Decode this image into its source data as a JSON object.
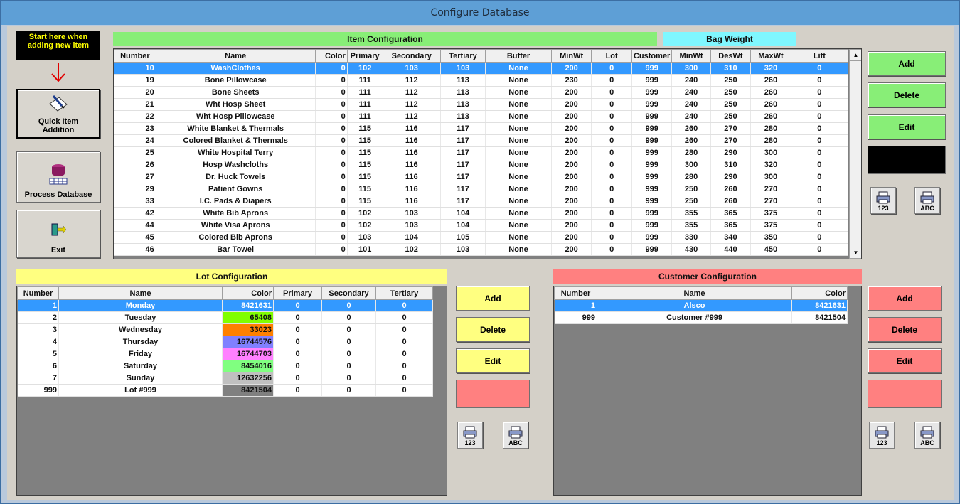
{
  "window": {
    "title": "Configure Database"
  },
  "sidebar": {
    "hint": "Start here when adding new item",
    "quick_item": "Quick Item Addition",
    "process_db": "Process Database",
    "exit": "Exit"
  },
  "item_config": {
    "title": "Item Configuration",
    "bag_weight_title": "Bag Weight",
    "columns": [
      "Number",
      "Name",
      "Color",
      "Primary",
      "Secondary",
      "Tertiary",
      "Buffer",
      "MinWt",
      "Lot",
      "Customer",
      "MinWt",
      "DesWt",
      "MaxWt",
      "Lift"
    ],
    "rows": [
      [
        "10",
        "WashClothes",
        "0",
        "102",
        "103",
        "103",
        "None",
        "200",
        "0",
        "999",
        "300",
        "310",
        "320",
        "0"
      ],
      [
        "19",
        "Bone Pillowcase",
        "0",
        "111",
        "112",
        "113",
        "None",
        "230",
        "0",
        "999",
        "240",
        "250",
        "260",
        "0"
      ],
      [
        "20",
        "Bone Sheets",
        "0",
        "111",
        "112",
        "113",
        "None",
        "200",
        "0",
        "999",
        "240",
        "250",
        "260",
        "0"
      ],
      [
        "21",
        "Wht Hosp Sheet",
        "0",
        "111",
        "112",
        "113",
        "None",
        "200",
        "0",
        "999",
        "240",
        "250",
        "260",
        "0"
      ],
      [
        "22",
        "Wht Hosp Pillowcase",
        "0",
        "111",
        "112",
        "113",
        "None",
        "200",
        "0",
        "999",
        "240",
        "250",
        "260",
        "0"
      ],
      [
        "23",
        "White Blanket & Thermals",
        "0",
        "115",
        "116",
        "117",
        "None",
        "200",
        "0",
        "999",
        "260",
        "270",
        "280",
        "0"
      ],
      [
        "24",
        "Colored Blanket & Thermals",
        "0",
        "115",
        "116",
        "117",
        "None",
        "200",
        "0",
        "999",
        "260",
        "270",
        "280",
        "0"
      ],
      [
        "25",
        "White Hospital Terry",
        "0",
        "115",
        "116",
        "117",
        "None",
        "200",
        "0",
        "999",
        "280",
        "290",
        "300",
        "0"
      ],
      [
        "26",
        "Hosp Washcloths",
        "0",
        "115",
        "116",
        "117",
        "None",
        "200",
        "0",
        "999",
        "300",
        "310",
        "320",
        "0"
      ],
      [
        "27",
        "Dr. Huck Towels",
        "0",
        "115",
        "116",
        "117",
        "None",
        "200",
        "0",
        "999",
        "280",
        "290",
        "300",
        "0"
      ],
      [
        "29",
        "Patient Gowns",
        "0",
        "115",
        "116",
        "117",
        "None",
        "200",
        "0",
        "999",
        "250",
        "260",
        "270",
        "0"
      ],
      [
        "33",
        "I.C. Pads & Diapers",
        "0",
        "115",
        "116",
        "117",
        "None",
        "200",
        "0",
        "999",
        "250",
        "260",
        "270",
        "0"
      ],
      [
        "42",
        "White Bib Aprons",
        "0",
        "102",
        "103",
        "104",
        "None",
        "200",
        "0",
        "999",
        "355",
        "365",
        "375",
        "0"
      ],
      [
        "44",
        "White Visa Aprons",
        "0",
        "102",
        "103",
        "104",
        "None",
        "200",
        "0",
        "999",
        "355",
        "365",
        "375",
        "0"
      ],
      [
        "45",
        "Colored Bib Aprons",
        "0",
        "103",
        "104",
        "105",
        "None",
        "200",
        "0",
        "999",
        "330",
        "340",
        "350",
        "0"
      ],
      [
        "46",
        "Bar Towel",
        "0",
        "101",
        "102",
        "103",
        "None",
        "200",
        "0",
        "999",
        "430",
        "440",
        "450",
        "0"
      ]
    ],
    "buttons": {
      "add": "Add",
      "delete": "Delete",
      "edit": "Edit"
    },
    "print_num": "123",
    "print_abc": "ABC"
  },
  "lot_config": {
    "title": "Lot Configuration",
    "columns": [
      "Number",
      "Name",
      "Color",
      "Primary",
      "Secondary",
      "Tertiary"
    ],
    "rows": [
      {
        "cells": [
          "1",
          "Monday",
          "8421631",
          "0",
          "0",
          "0"
        ],
        "color": "#3399ff"
      },
      {
        "cells": [
          "2",
          "Tuesday",
          "65408",
          "0",
          "0",
          "0"
        ],
        "color": "#80ff00"
      },
      {
        "cells": [
          "3",
          "Wednesday",
          "33023",
          "0",
          "0",
          "0"
        ],
        "color": "#ff8000"
      },
      {
        "cells": [
          "4",
          "Thursday",
          "16744576",
          "0",
          "0",
          "0"
        ],
        "color": "#8080ff"
      },
      {
        "cells": [
          "5",
          "Friday",
          "16744703",
          "0",
          "0",
          "0"
        ],
        "color": "#ff80ff"
      },
      {
        "cells": [
          "6",
          "Saturday",
          "8454016",
          "0",
          "0",
          "0"
        ],
        "color": "#80ff80"
      },
      {
        "cells": [
          "7",
          "Sunday",
          "12632256",
          "0",
          "0",
          "0"
        ],
        "color": "#c0c0c0"
      },
      {
        "cells": [
          "999",
          "Lot #999",
          "8421504",
          "0",
          "0",
          "0"
        ],
        "color": "#808080"
      }
    ],
    "buttons": {
      "add": "Add",
      "delete": "Delete",
      "edit": "Edit"
    },
    "print_num": "123",
    "print_abc": "ABC"
  },
  "customer_config": {
    "title": "Customer Configuration",
    "columns": [
      "Number",
      "Name",
      "Color"
    ],
    "rows": [
      [
        "1",
        "Alsco",
        "8421631"
      ],
      [
        "999",
        "Customer #999",
        "8421504"
      ]
    ],
    "buttons": {
      "add": "Add",
      "delete": "Delete",
      "edit": "Edit"
    },
    "print_num": "123",
    "print_abc": "ABC"
  },
  "colors": {
    "item_accent": "#88ee77",
    "bag_accent": "#7ff7ff",
    "lot_accent": "#ffff80",
    "customer_accent": "#ff8080"
  }
}
